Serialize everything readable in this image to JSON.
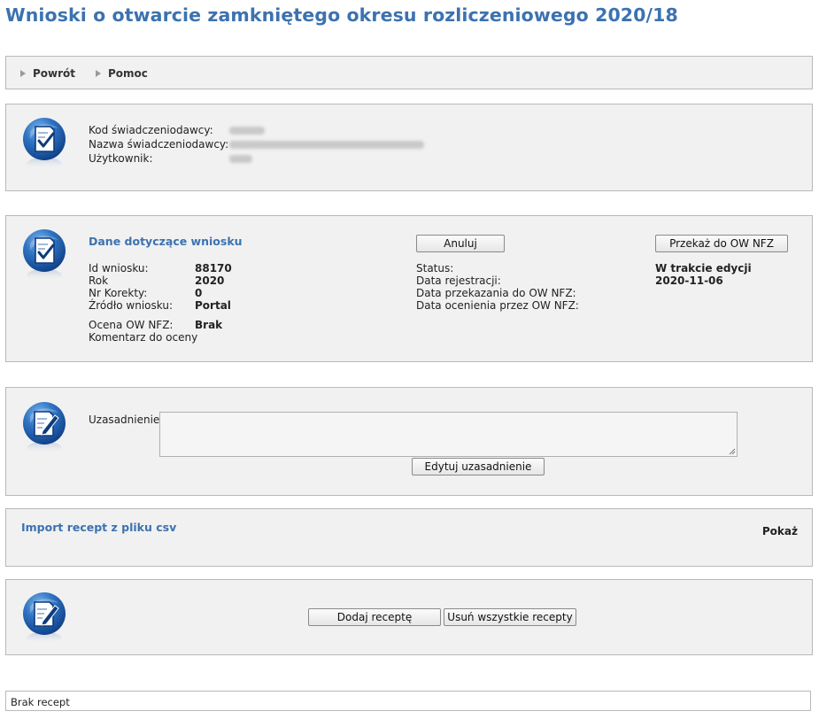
{
  "page": {
    "title": "Wnioski o otwarcie zamkniętego okresu rozliczeniowego 2020/18"
  },
  "toolbar": {
    "back_label": "Powrót",
    "help_label": "Pomoc"
  },
  "provider": {
    "code_label": "Kod świadczeniodawcy:",
    "name_label": "Nazwa świadczeniodawcy:",
    "user_label": "Użytkownik:"
  },
  "application": {
    "section_title": "Dane dotyczące wniosku",
    "cancel_button": "Anuluj",
    "send_button": "Przekaż do OW NFZ",
    "id_label": "Id wniosku:",
    "id_value": "88170",
    "year_label": "Rok",
    "year_value": "2020",
    "correction_label": "Nr Korekty:",
    "correction_value": "0",
    "source_label": "Źródło wniosku:",
    "source_value": "Portal",
    "rating_label": "Ocena OW NFZ:",
    "rating_value": "Brak",
    "comment_label": "Komentarz do oceny",
    "status_label": "Status:",
    "status_value": "W trakcie edycji",
    "registration_label": "Data rejestracji:",
    "registration_value": "2020-11-06",
    "sent_label": "Data przekazania do OW NFZ:",
    "evaluated_label": "Data ocenienia przez OW NFZ:"
  },
  "justification": {
    "label": "Uzasadnienie:",
    "value": "",
    "edit_button": "Edytuj uzasadnienie"
  },
  "import": {
    "title": "Import recept z pliku csv",
    "show_link": "Pokaż"
  },
  "prescriptions": {
    "add_button": "Dodaj receptę",
    "remove_all_button": "Usuń wszystkie recepty",
    "empty_text": "Brak recept"
  },
  "colors": {
    "accent": "#3c72b0",
    "panel_bg": "#f1f1f1",
    "panel_border": "#b9b9b9"
  },
  "icons": {
    "document_check": "document-check-icon",
    "document_edit": "document-edit-icon",
    "toolbar_arrow": "triangle-right-icon"
  }
}
